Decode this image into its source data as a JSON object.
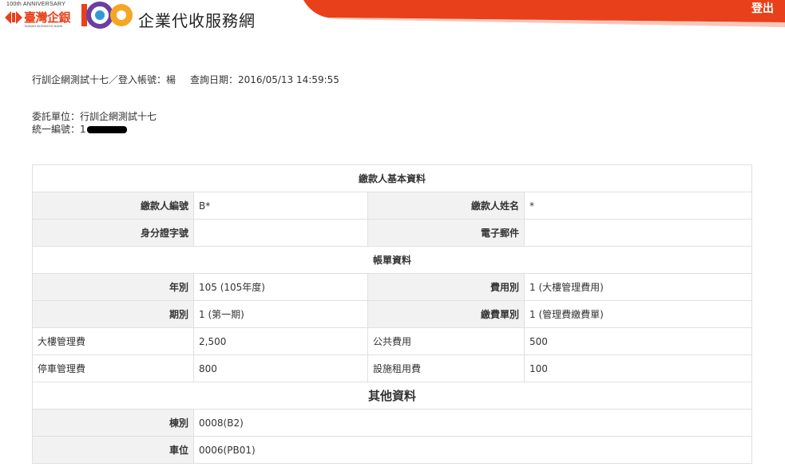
{
  "header": {
    "logo_anniversary": "100th ANNIVERSARY",
    "logo_bank_name": "臺灣企銀",
    "logo_bank_en": "TAIWAN BUSINESS BANK",
    "site_title": "企業代收服務網",
    "logout_label": "登出",
    "brand_color": "#e8401a",
    "logo_icon": "tbb-anniversary-logo"
  },
  "info": {
    "account_line": "行訓企網測試十七／登入帳號：楊",
    "query_date": "查詢日期：2016/05/13 14:59:55",
    "entrusting_unit": "委託單位：行訓企網測試十七",
    "tax_id_label": "統一編號：1"
  },
  "payer_section": {
    "title": "繳款人基本資料",
    "payer_id_label": "繳款人編號",
    "payer_id_value": "B*",
    "payer_name_label": "繳款人姓名",
    "payer_name_value": "*",
    "national_id_label": "身分證字號",
    "national_id_value": "",
    "email_label": "電子郵件",
    "email_value": ""
  },
  "bill_section": {
    "title": "帳單資料",
    "year_label": "年別",
    "year_value": "105 (105年度)",
    "fee_type_label": "費用別",
    "fee_type_value": "1 (大樓管理費用)",
    "period_label": "期別",
    "period_value": "1 (第一期)",
    "bill_type_label": "繳費單別",
    "bill_type_value": "1 (管理費繳費單)",
    "items": [
      {
        "name": "大樓管理費",
        "amount": "2,500",
        "name2": "公共費用",
        "amount2": "500"
      },
      {
        "name": "停車管理費",
        "amount": "800",
        "name2": "設施租用費",
        "amount2": "100"
      }
    ]
  },
  "other_section": {
    "title": "其他資料",
    "building_label": "棟別",
    "building_value": "0008(B2)",
    "parking_label": "車位",
    "parking_value": "0006(PB01)"
  }
}
